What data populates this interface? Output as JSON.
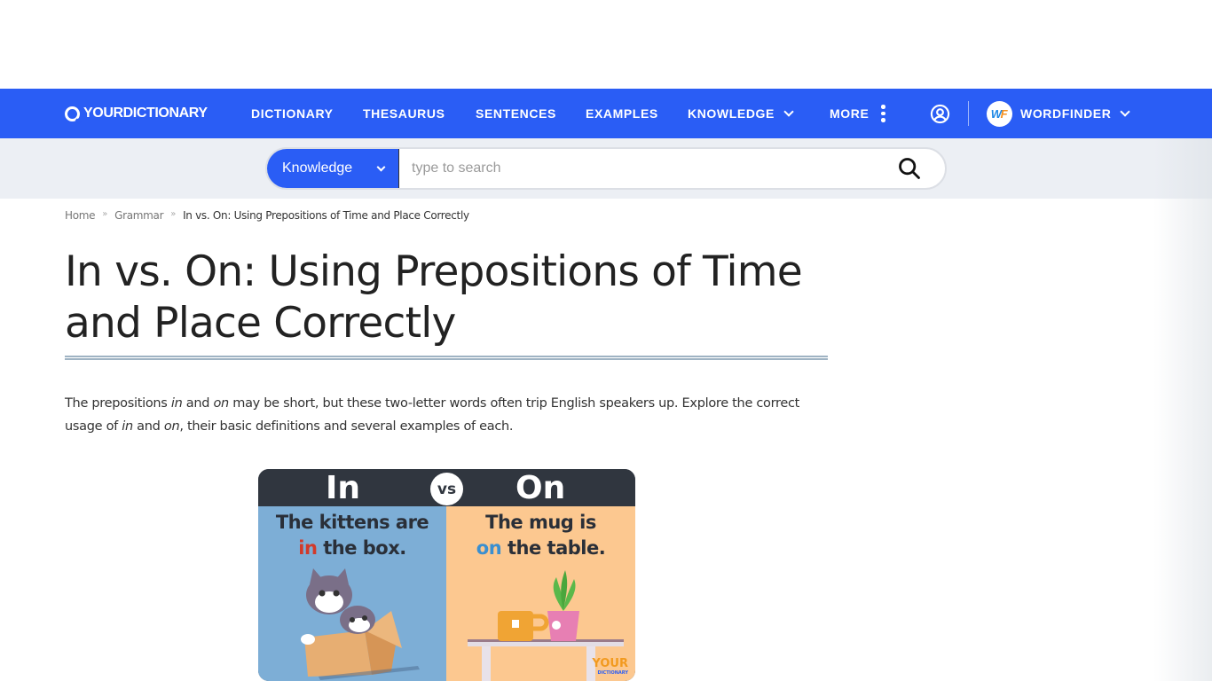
{
  "brand": {
    "logo_text": "YOURDICTIONARY",
    "primary_color": "#2a5df5"
  },
  "nav": {
    "items": [
      {
        "label": "DICTIONARY"
      },
      {
        "label": "THESAURUS"
      },
      {
        "label": "SENTENCES"
      },
      {
        "label": "EXAMPLES"
      },
      {
        "label": "KNOWLEDGE"
      },
      {
        "label": "MORE"
      }
    ],
    "account_icon": "user-circle-icon",
    "wordfinder": {
      "badge": "WF",
      "label": "WORDFINDER"
    }
  },
  "search": {
    "category_selected": "Knowledge",
    "placeholder": "type to search",
    "value": "",
    "button_icon": "search-icon"
  },
  "breadcrumb": {
    "items": [
      {
        "label": "Home"
      },
      {
        "label": "Grammar"
      }
    ],
    "separator": "»",
    "current": "In vs. On: Using Prepositions of Time and Place Correctly"
  },
  "article": {
    "title": "In vs. On: Using Prepositions of Time and Place Correctly",
    "intro": {
      "p1": "The prepositions ",
      "em1": "in",
      "p2": " and ",
      "em2": "on",
      "p3": " may be short, but these two-letter words often trip English speakers up. Explore the correct usage of ",
      "em3": "in",
      "p4": " and ",
      "em4": "on",
      "p5": ", their basic definitions and several examples of each."
    },
    "figure": {
      "left_label": "In",
      "vs_label": "vs",
      "right_label": "On",
      "left_caption_1": "The kittens are",
      "left_caption_highlight": "in",
      "left_caption_2": " the box.",
      "right_caption_1": "The mug is",
      "right_caption_highlight": "on",
      "right_caption_2": " the table.",
      "watermark": "YOUR",
      "watermark_sub": "DICTIONARY"
    }
  }
}
